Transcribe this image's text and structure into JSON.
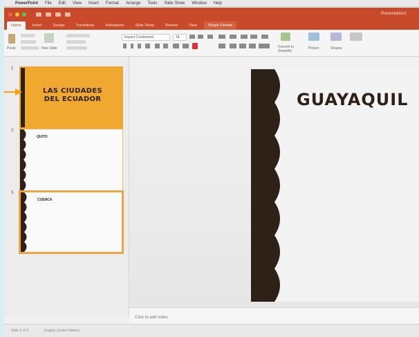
{
  "menubar": {
    "apple_icon": "apple-icon",
    "items": [
      "PowerPoint",
      "File",
      "Edit",
      "View",
      "Insert",
      "Format",
      "Arrange",
      "Tools",
      "Slide Show",
      "Window",
      "Help"
    ]
  },
  "titlebar": {
    "document_title": "Presentation1",
    "traffic_light_colors": [
      "#ee5d52",
      "#f5bd3b",
      "#5ac640"
    ]
  },
  "ribbon_tabs": [
    {
      "label": "Home",
      "state": "active"
    },
    {
      "label": "Insert",
      "state": "normal"
    },
    {
      "label": "Design",
      "state": "normal"
    },
    {
      "label": "Transitions",
      "state": "normal"
    },
    {
      "label": "Animations",
      "state": "normal"
    },
    {
      "label": "Slide Show",
      "state": "normal"
    },
    {
      "label": "Review",
      "state": "normal"
    },
    {
      "label": "View",
      "state": "normal"
    },
    {
      "label": "Shape Format",
      "state": "context"
    }
  ],
  "ribbon": {
    "paste_label": "Paste",
    "new_slide_label": "New Slide",
    "font_name": "Impact Condensed",
    "font_size": "18",
    "convert_label": "Convert to SmartArt",
    "picture_label": "Picture",
    "shapes_label": "Shapes"
  },
  "slides": [
    {
      "number": "1",
      "title": "LAS CIUDADES DEL ECUADOR"
    },
    {
      "number": "2",
      "title": "QUITO"
    },
    {
      "number": "3",
      "title": "CUENCA"
    }
  ],
  "current_slide": {
    "title": "GUAYAQUIL"
  },
  "notes_placeholder": "Click to add notes",
  "status": {
    "slide_counter": "Slide 3 of 3",
    "language": "English (United States)"
  },
  "colors": {
    "accent": "#c94a2a",
    "slide_orange": "#f0a830",
    "dark_brown": "#2e2118",
    "callout_arrow": "#f2a20b"
  }
}
